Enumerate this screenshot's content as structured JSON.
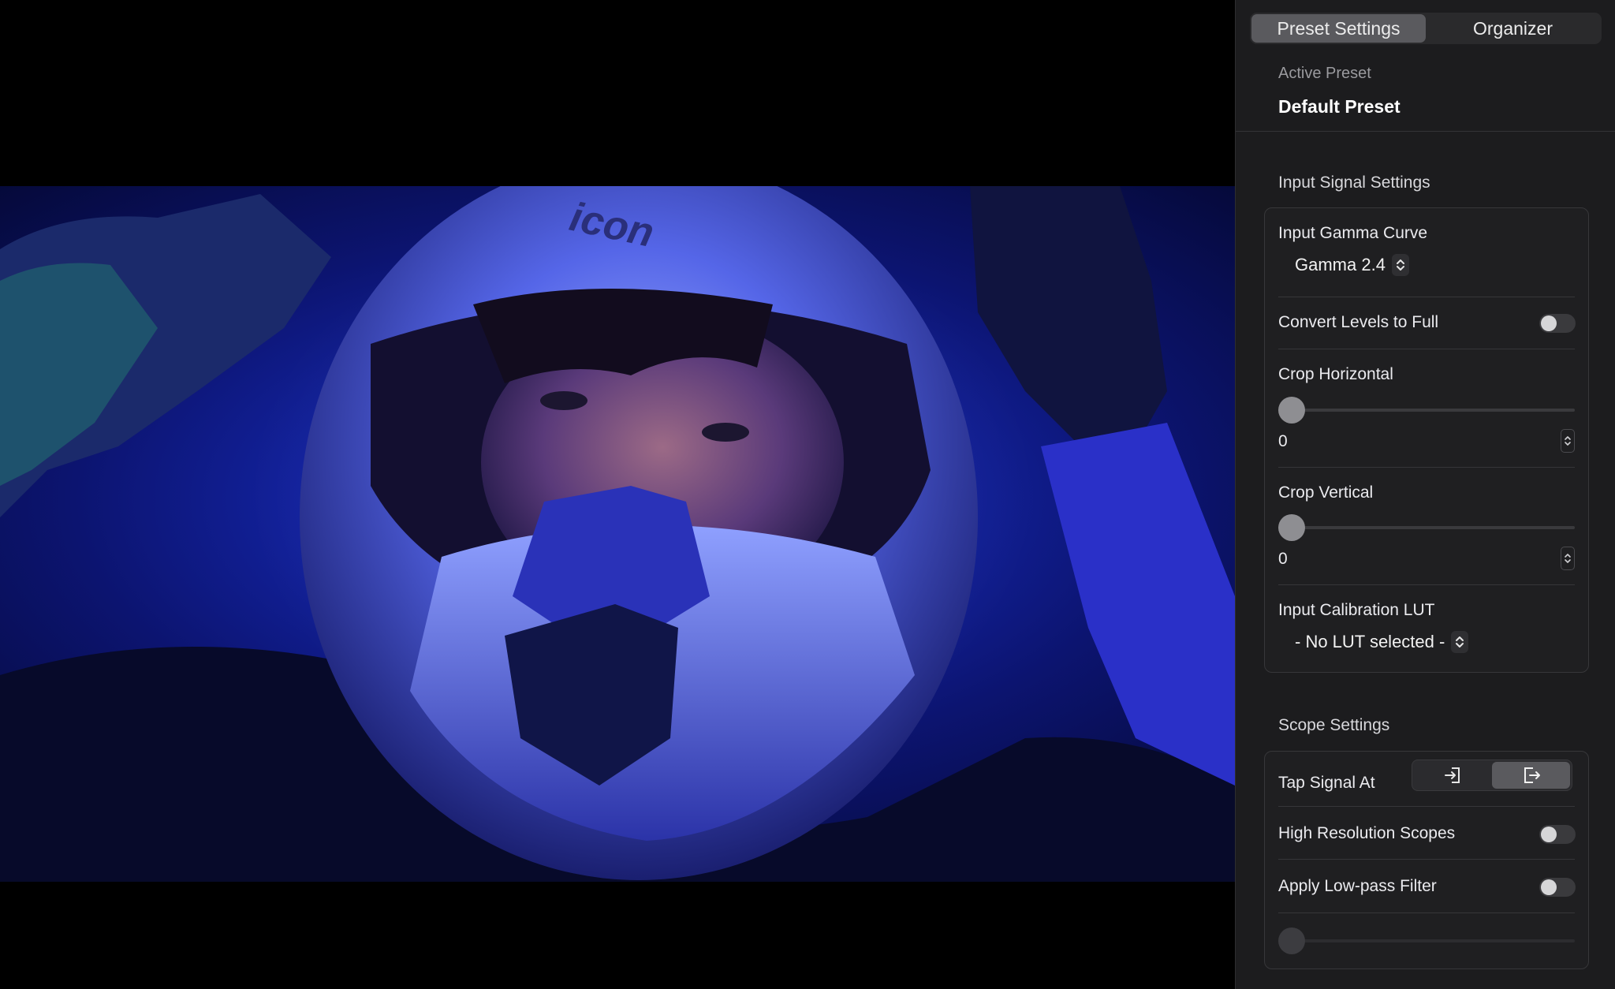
{
  "tabs": [
    {
      "label": "Preset Settings",
      "active": true
    },
    {
      "label": "Organizer",
      "active": false
    }
  ],
  "preset": {
    "label": "Active Preset",
    "value": "Default Preset"
  },
  "input_signal": {
    "title": "Input Signal Settings",
    "gamma_label": "Input Gamma Curve",
    "gamma_value": "Gamma 2.4",
    "convert_label": "Convert Levels to Full",
    "convert_on": false,
    "crop_h_label": "Crop Horizontal",
    "crop_h_value": "0",
    "crop_v_label": "Crop Vertical",
    "crop_v_value": "0",
    "lut_label": "Input Calibration LUT",
    "lut_value": "- No LUT selected -"
  },
  "scope": {
    "title": "Scope Settings",
    "tap_label": "Tap Signal At",
    "tap_selected": "output",
    "highres_label": "High Resolution Scopes",
    "highres_on": false,
    "lowpass_label": "Apply Low-pass Filter",
    "lowpass_on": false,
    "lowpass_level": 0
  },
  "colors": {
    "sidebar_bg": "#1c1c1e",
    "active_segment": "#5a5a5e",
    "image_tint": "#1a33d9"
  },
  "icons": {
    "tap_input": "arrow-into-box-icon",
    "tap_output": "arrow-out-of-box-icon",
    "popup": "updown-chevron-icon"
  },
  "image": {
    "logo_text": "icon"
  }
}
